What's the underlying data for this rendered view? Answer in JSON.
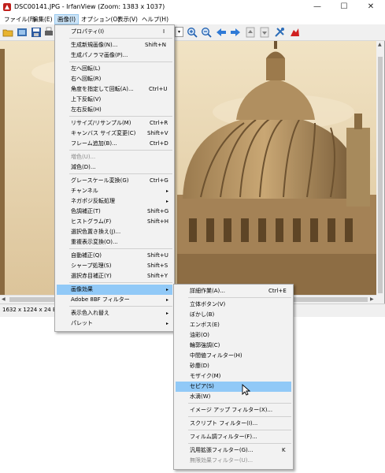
{
  "window": {
    "title": "DSC00141.JPG - IrfanView (Zoom: 1383 x 1037)",
    "minimize": "—",
    "maximize": "☐",
    "close": "✕"
  },
  "menubar": {
    "items": [
      {
        "label": "ファイル(F)"
      },
      {
        "label": "編集(E)"
      },
      {
        "label": "画像(I)"
      },
      {
        "label": "オプション(O)"
      },
      {
        "label": "表示(V)"
      },
      {
        "label": "ヘルプ(H)"
      }
    ]
  },
  "toolbar": {
    "icons": [
      "open-folder-icon",
      "slideshow-icon",
      "save-icon",
      "print-icon",
      "zoom-in-icon",
      "zoom-out-icon",
      "back-arrow-icon",
      "forward-arrow-icon",
      "first-page-icon",
      "last-page-icon",
      "settings-icon",
      "irfanview-logo-icon"
    ]
  },
  "status": {
    "text": "1632 x 1224 x 24 BPP"
  },
  "image_menu": {
    "items": [
      {
        "label": "プロパティ(I)",
        "shortcut": "I"
      },
      {
        "label": "生成新規画像(N)...",
        "shortcut": "Shift+N"
      },
      {
        "label": "生成パノラマ画像(P)...",
        "shortcut": ""
      },
      {
        "label": "左へ回転(L)",
        "shortcut": ""
      },
      {
        "label": "右へ回転(R)",
        "shortcut": ""
      },
      {
        "label": "角度を指定して回転(A)...",
        "shortcut": "Ctrl+U"
      },
      {
        "label": "上下反転(V)",
        "shortcut": ""
      },
      {
        "label": "左右反転(H)",
        "shortcut": ""
      },
      {
        "label": "リサイズ/リサンプル(M)",
        "shortcut": "Ctrl+R"
      },
      {
        "label": "キャンバス サイズ変更(C)",
        "shortcut": "Shift+V"
      },
      {
        "label": "フレーム追加(B)...",
        "shortcut": "Ctrl+D"
      },
      {
        "label": "増色(U)...",
        "shortcut": ""
      },
      {
        "label": "減色(D)...",
        "shortcut": ""
      },
      {
        "label": "グレースケール変換(G)",
        "shortcut": "Ctrl+G"
      },
      {
        "label": "チャンネル",
        "shortcut": ""
      },
      {
        "label": "ネガポジ反転処理",
        "shortcut": ""
      },
      {
        "label": "色調補正(T)",
        "shortcut": "Shift+G"
      },
      {
        "label": "ヒストグラム(F)",
        "shortcut": "Shift+H"
      },
      {
        "label": "選択色置き換え(J)...",
        "shortcut": ""
      },
      {
        "label": "重複表示変換(O)...",
        "shortcut": ""
      },
      {
        "label": "自動補正(Q)",
        "shortcut": "Shift+U"
      },
      {
        "label": "シャープ処理(S)",
        "shortcut": "Shift+S"
      },
      {
        "label": "選択赤目補正(Y)",
        "shortcut": "Shift+Y"
      },
      {
        "label": "画像効果",
        "shortcut": ""
      },
      {
        "label": "Adobe 8BF フィルター",
        "shortcut": ""
      },
      {
        "label": "表示色入れ替え",
        "shortcut": ""
      },
      {
        "label": "パレット",
        "shortcut": ""
      }
    ]
  },
  "effects_menu": {
    "items": [
      {
        "label": "詳細作業(A)...",
        "shortcut": "Ctrl+E"
      },
      {
        "label": "立体ボタン(V)",
        "shortcut": ""
      },
      {
        "label": "ぼかし(B)",
        "shortcut": ""
      },
      {
        "label": "エンボス(E)",
        "shortcut": ""
      },
      {
        "label": "油彩(O)",
        "shortcut": ""
      },
      {
        "label": "輪郭強調(C)",
        "shortcut": ""
      },
      {
        "label": "中間値フィルター(H)",
        "shortcut": ""
      },
      {
        "label": "砂塵(D)",
        "shortcut": ""
      },
      {
        "label": "モザイク(M)",
        "shortcut": ""
      },
      {
        "label": "セピア(S)",
        "shortcut": ""
      },
      {
        "label": "水滴(W)",
        "shortcut": ""
      },
      {
        "label": "イメージ アップ フィルター(X)...",
        "shortcut": ""
      },
      {
        "label": "スクリプト フィルター(I)...",
        "shortcut": ""
      },
      {
        "label": "フィルム調フィルター(F)...",
        "shortcut": ""
      },
      {
        "label": "汎用拡張フィルター(G)...",
        "shortcut": "K"
      },
      {
        "label": "無限効果フィルター(U)...",
        "shortcut": ""
      }
    ]
  }
}
